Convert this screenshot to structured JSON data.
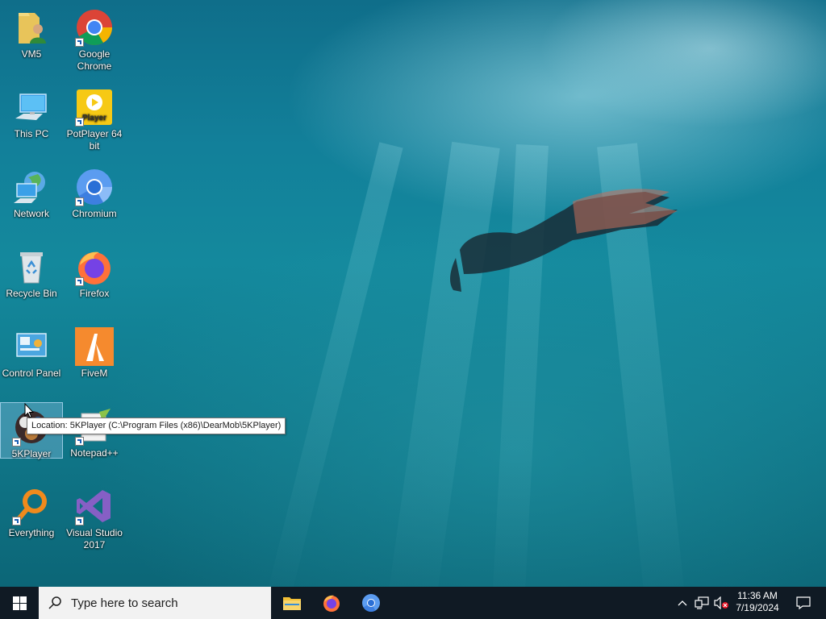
{
  "desktop": {
    "icons": [
      {
        "label": "VM5"
      },
      {
        "label": "Google Chrome"
      },
      {
        "label": "This PC"
      },
      {
        "label": "PotPlayer 64 bit"
      },
      {
        "label": "Network"
      },
      {
        "label": "Chromium"
      },
      {
        "label": "Recycle Bin"
      },
      {
        "label": "Firefox"
      },
      {
        "label": "Control Panel"
      },
      {
        "label": "FiveM"
      },
      {
        "label": "5KPlayer"
      },
      {
        "label": "Notepad++"
      },
      {
        "label": "Everything"
      },
      {
        "label": "Visual Studio 2017"
      }
    ],
    "potplayer_logo_text": "Player",
    "tooltip": "Location: 5KPlayer (C:\\Program Files (x86)\\DearMob\\5KPlayer)"
  },
  "taskbar": {
    "search_placeholder": "Type here to search",
    "pinned": [
      "file-explorer",
      "firefox",
      "chromium"
    ],
    "clock": {
      "time": "11:36 AM",
      "date": "7/19/2024"
    }
  },
  "colors": {
    "taskbar_bg": "#101a24",
    "search_bg": "#f2f2f2",
    "accent_blue": "#1a73e8"
  }
}
